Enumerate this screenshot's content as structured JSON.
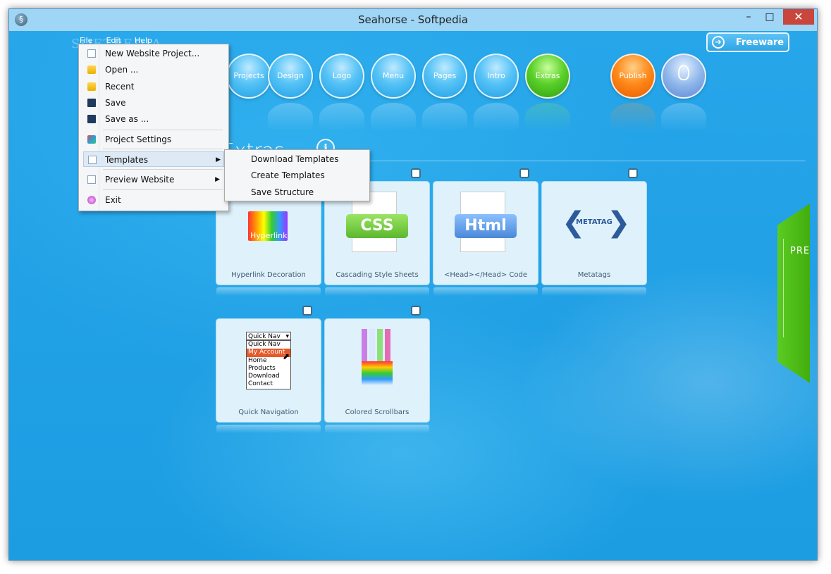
{
  "window": {
    "title": "Seahorse - Softpedia"
  },
  "menubar": {
    "file": "File",
    "edit": "Edit",
    "help": "Help"
  },
  "watermark": "SOFTPEDIA",
  "freeware": {
    "label": "Freeware"
  },
  "nav": [
    {
      "label": "Projects",
      "style": "blue"
    },
    {
      "label": "Design",
      "style": "blue"
    },
    {
      "label": "Logo",
      "style": "blue"
    },
    {
      "label": "Menu",
      "style": "blue"
    },
    {
      "label": "Pages",
      "style": "blue"
    },
    {
      "label": "Intro",
      "style": "blue"
    },
    {
      "label": "Extras",
      "style": "green"
    },
    {
      "label": "Publish",
      "style": "orange"
    }
  ],
  "section": {
    "title": "Extras"
  },
  "cards": [
    {
      "label": "Hyperlink Decoration",
      "thumb_text": "Hyperlink"
    },
    {
      "label": "Cascading Style Sheets",
      "thumb_text": "CSS"
    },
    {
      "label": "<Head></Head> Code",
      "thumb_text": "Html"
    },
    {
      "label": "Metatags",
      "thumb_text": "METATAG"
    },
    {
      "label": "Quick Navigation",
      "thumb_text": "Quick Nav",
      "thumb_items": [
        "Quick Nav",
        "My Account",
        "Home",
        "Products",
        "Download",
        "Contact"
      ]
    },
    {
      "label": "Colored Scrollbars"
    }
  ],
  "file_menu": {
    "items": [
      {
        "label": "New Website Project..."
      },
      {
        "label": "Open ..."
      },
      {
        "label": "Recent"
      },
      {
        "label": "Save"
      },
      {
        "label": "Save as ..."
      },
      {
        "label": "Project Settings"
      },
      {
        "label": "Templates"
      },
      {
        "label": "Preview Website"
      },
      {
        "label": "Exit"
      }
    ]
  },
  "templates_submenu": {
    "items": [
      {
        "label": "Download Templates"
      },
      {
        "label": "Create Templates"
      },
      {
        "label": "Save Structure"
      }
    ]
  },
  "preview_tab": {
    "label": "PREVIEW"
  },
  "colors": {
    "accent": "#2ba6e8",
    "extras": "#4cc21c",
    "publish": "#ff7a10",
    "preview": "#4fbd18"
  }
}
